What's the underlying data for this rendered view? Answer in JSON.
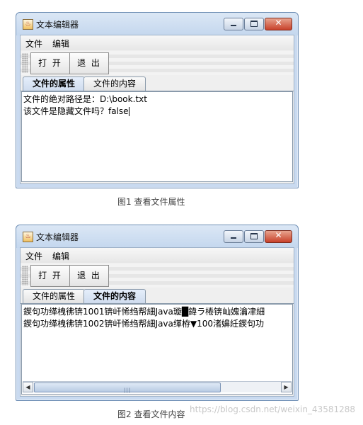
{
  "window1": {
    "title": "文本编辑器",
    "menu": [
      "文件",
      "编辑"
    ],
    "toolbar": {
      "open_label": "打 开",
      "exit_label": "退 出"
    },
    "tabs": [
      {
        "label": "文件的属性",
        "active": true
      },
      {
        "label": "文件的内容",
        "active": false
      }
    ],
    "content_lines": [
      "文件的绝对路径是：D:\\book.txt",
      "该文件是隐藏文件吗？false"
    ]
  },
  "caption1": "图1 查看文件属性",
  "window2": {
    "title": "文本编辑器",
    "menu": [
      "文件",
      "编辑"
    ],
    "toolbar": {
      "open_label": "打 开",
      "exit_label": "退 出"
    },
    "tabs": [
      {
        "label": "文件的属性",
        "active": false
      },
      {
        "label": "文件的内容",
        "active": true
      }
    ],
    "content_lines": [
      "鍥句功缂栧彿锛1001锛屽悕绉帮細Java璇█鍏ラ棬锛屾媿瀹冿細",
      "鍥句功缂栧彿锛1002锛屽悕绉帮細Java缂栫▼100渚嬶紝鍥句功"
    ]
  },
  "caption2": "图2 查看文件内容",
  "watermark": "https://blog.csdn.net/weixin_43581288",
  "icons": {
    "app": "java-cup-icon",
    "minimize": "minimize-icon",
    "maximize": "maximize-icon",
    "close": "close-icon",
    "scroll_left": "arrow-left-icon",
    "scroll_right": "arrow-right-icon"
  },
  "colors": {
    "titlebar": "#c4d7ee",
    "close_button": "#c8412a",
    "active_tab": "#cfdcee"
  }
}
